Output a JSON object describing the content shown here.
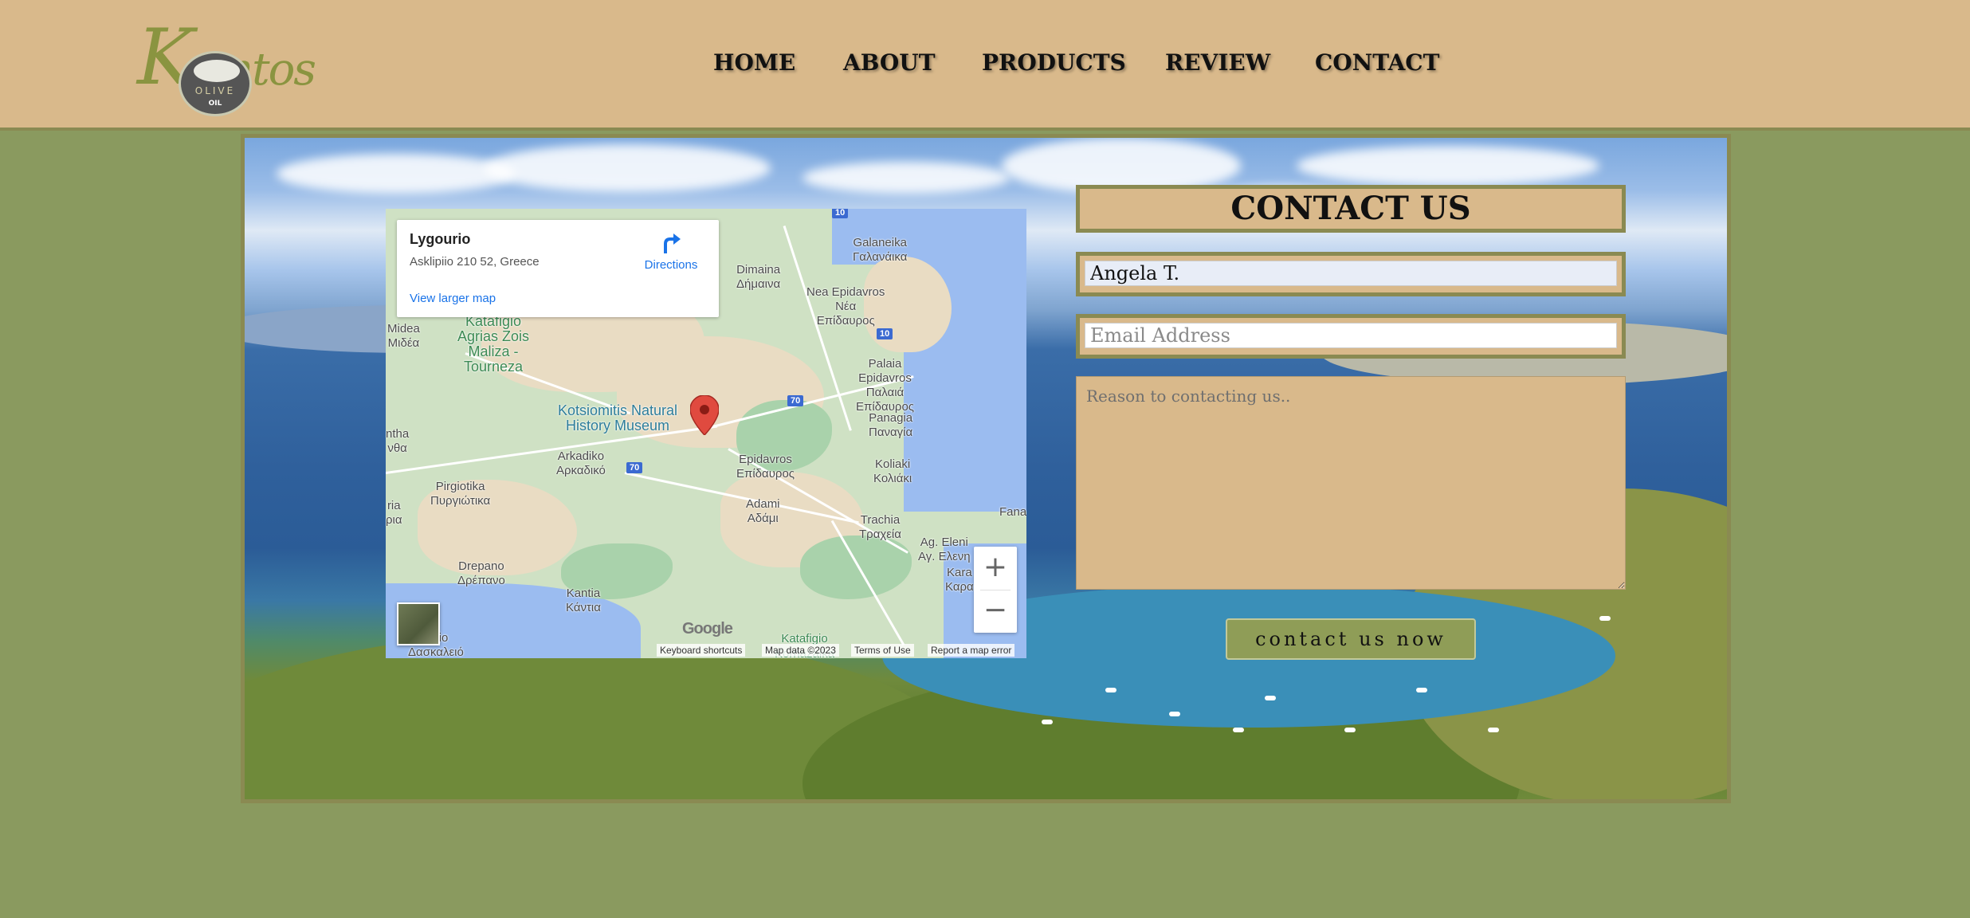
{
  "brand": {
    "logo_word": "Kontos",
    "logo_badge_word": "OLIVE",
    "logo_badge_sub": "OIL"
  },
  "nav": {
    "items": [
      "HOME",
      "ABOUT",
      "PRODUCTS",
      "REVIEW",
      "CONTACT"
    ]
  },
  "map": {
    "place_name": "Lygourio",
    "address": "Asklipiio 210 52, Greece",
    "directions_label": "Directions",
    "larger_map_link": "View larger map",
    "google_logo": "Google",
    "footer": {
      "keyboard": "Keyboard shortcuts",
      "map_data": "Map data ©2023",
      "terms": "Terms of Use",
      "report": "Report a map error"
    },
    "zoom_in": "+",
    "zoom_out": "−",
    "labels": {
      "galaneika": "Galaneika\nΓαλανάικα",
      "dimaina": "Dimaina\nΔήμαινα",
      "nea_epidavros": "Nea Epidavros\nΝέα\nΕπίδαυρος",
      "midea": "Midea\nΜιδέα",
      "katafigio": "Katafigio\nAgrias Zois\nMaliza -\nTourneza",
      "palaia_epidavros": "Palaia\nEpidavros\nΠαλαιά\nΕπίδαυρος",
      "panagia": "Panagia\nΠαναγία",
      "kotsiomitis": "Kotsiomitis Natural\nHistory Museum",
      "ntha": "ntha\nνθα",
      "arkadiko": "Arkadiko\nΑρκαδικό",
      "epidavros": "Epidavros\nΕπίδαυρος",
      "koliaki": "Koliaki\nΚολιάκι",
      "pirgiotika": "Pirgiotika\nΠυργιώτικα",
      "ria": "ria\nρια",
      "adami": "Adami\nΑδάμι",
      "trachia": "Trachia\nΤραχεία",
      "fana": "Fana",
      "ag_eleni": "Ag. Eleni\nΑγ. Ελενη",
      "kara": "Kara\nΚαρα",
      "drepano": "Drepano\nΔρέπανο",
      "kantia": "Kantia\nΚάντια",
      "kalio": "kalio\nΔασκαλειό",
      "katafigio_s": "Katafigio\nKornazaika"
    },
    "shields": [
      "10",
      "10",
      "70",
      "70"
    ]
  },
  "contact": {
    "title": "CONTACT US",
    "name_value": "Angela T.",
    "email_placeholder": "Email Address",
    "reason_placeholder": "Reason to contacting us..",
    "submit_label": "contact us now"
  }
}
